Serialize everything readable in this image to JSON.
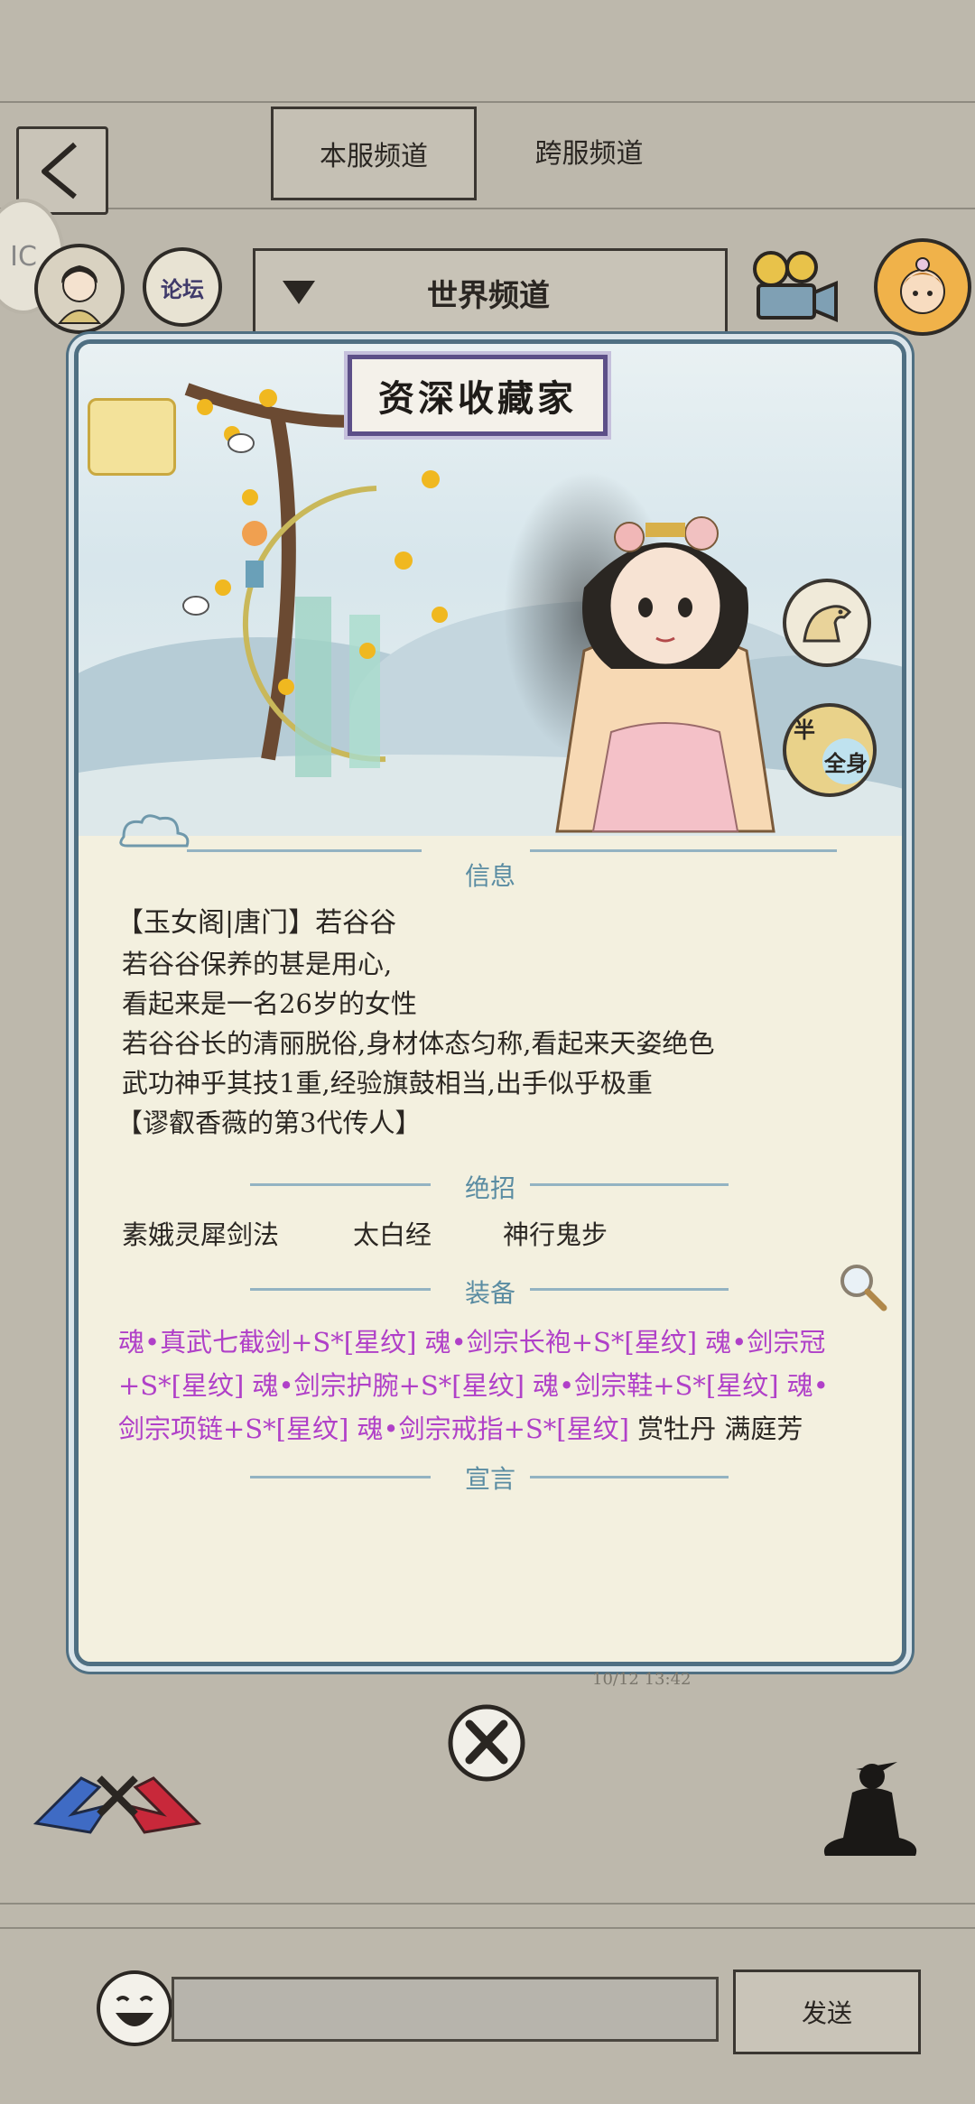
{
  "tabs": {
    "server": "本服频道",
    "cross": "跨服频道"
  },
  "header": {
    "forum": "论坛",
    "channel": "世界频道"
  },
  "card": {
    "title_plate": "资深收藏家",
    "mounted_label": "半",
    "full_label": "全身",
    "sections": {
      "info": "信息",
      "skills": "绝招",
      "equipment": "装备",
      "declaration": "宣言"
    },
    "info_lines": [
      "【玉女阁|唐门】若谷谷",
      "若谷谷保养的甚是用心,",
      "看起来是一名26岁的女性",
      "若谷谷长的清丽脱俗,身材体态匀称,看起来天姿绝色",
      "武功神乎其技1重,经验旗鼓相当,出手似乎极重",
      "【谬叡香薇的第3代传人】"
    ],
    "skills": [
      "素娥灵犀剑法",
      "太白经",
      "神行鬼步"
    ],
    "equip_lines": [
      [
        {
          "t": "魂•真武七截剑+S*[星纹]",
          "c": "purple"
        },
        {
          "t": " 魂•剑宗长袍+S*[星纹]",
          "c": "purple"
        },
        {
          "t": " 魂•剑宗冠",
          "c": "purple"
        }
      ],
      [
        {
          "t": "+S*[星纹]",
          "c": "purple"
        },
        {
          "t": " 魂•剑宗护腕+S*[星纹]",
          "c": "purple"
        },
        {
          "t": " 魂•剑宗鞋+S*[星纹]",
          "c": "purple"
        },
        {
          "t": " 魂•",
          "c": "purple"
        }
      ],
      [
        {
          "t": "剑宗项链+S*[星纹]",
          "c": "purple"
        },
        {
          "t": " 魂•剑宗戒指+S*[星纹]",
          "c": "purple"
        },
        {
          "t": " 赏牡丹 满庭芳",
          "c": "dark"
        }
      ]
    ],
    "timestamp": "10/12 13:42"
  },
  "chat": {
    "send": "发送"
  },
  "colors": {
    "purple": "#b040c8",
    "section": "#5a8ca2",
    "frame": "#4f6f82"
  },
  "icons": [
    "back-icon",
    "avatar-icon",
    "forum-icon",
    "camera-icon",
    "user-avatar-icon",
    "horse-icon",
    "magnifier-icon",
    "close-icon",
    "versus-icon",
    "meditate-icon",
    "emoji-icon"
  ]
}
